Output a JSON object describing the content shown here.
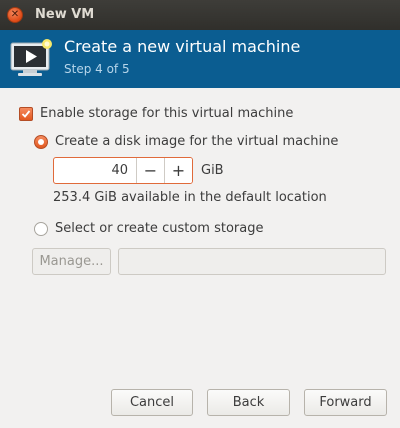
{
  "window": {
    "title": "New VM"
  },
  "header": {
    "title": "Create a new virtual machine",
    "step": "Step 4 of 5"
  },
  "storage": {
    "enable_label": "Enable storage for this virtual machine",
    "enable_checked": true,
    "disk_image_label": "Create a disk image for the virtual machine",
    "disk_image_selected": true,
    "size_value": "40",
    "size_unit": "GiB",
    "minus": "−",
    "plus": "+",
    "available_text": "253.4 GiB available in the default location",
    "custom_label": "Select or create custom storage",
    "custom_selected": false,
    "manage_label": "Manage...",
    "custom_path_value": ""
  },
  "buttons": {
    "cancel": "Cancel",
    "back": "Back",
    "forward": "Forward"
  },
  "colors": {
    "accent": "#e2581f",
    "header_bg": "#0b5d91",
    "titlebar_bg": "#3c3b37"
  }
}
